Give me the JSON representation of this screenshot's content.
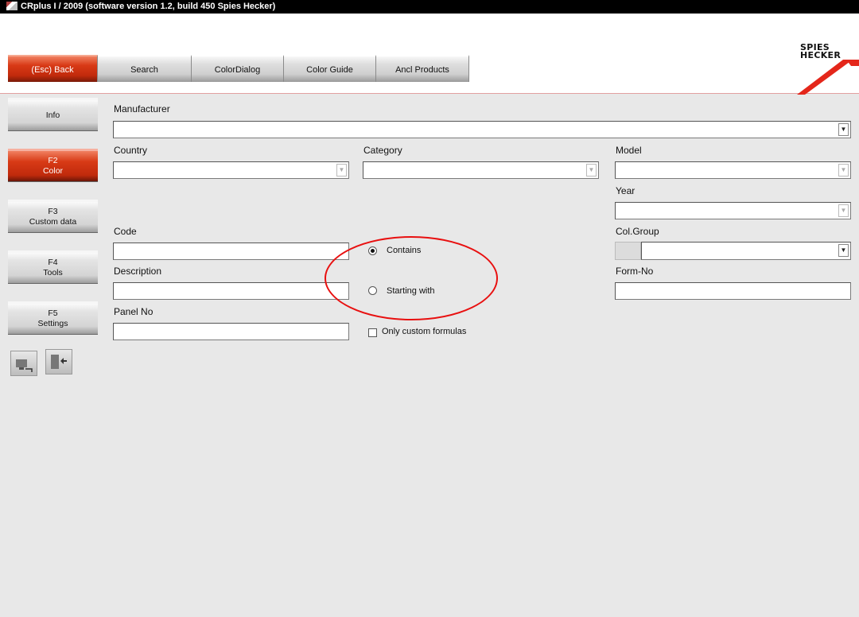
{
  "window": {
    "title": "CRplus I / 2009 (software version 1.2, build 450 Spies Hecker)"
  },
  "toolbar": {
    "back": "(Esc) Back",
    "search": "Search",
    "color_dialog": "ColorDialog",
    "color_guide": "Color Guide",
    "ancl_products": "Ancl Products"
  },
  "logo": {
    "line1": "SPIES",
    "line2": "HECKER"
  },
  "sidebar": {
    "info": "Info",
    "color_key": "F2",
    "color_label": "Color",
    "custom_key": "F3",
    "custom_label": "Custom data",
    "tools_key": "F4",
    "tools_label": "Tools",
    "settings_key": "F5",
    "settings_label": "Settings"
  },
  "form": {
    "manufacturer": {
      "label": "Manufacturer",
      "value": ""
    },
    "country": {
      "label": "Country",
      "value": ""
    },
    "category": {
      "label": "Category",
      "value": ""
    },
    "model": {
      "label": "Model",
      "value": ""
    },
    "year": {
      "label": "Year",
      "value": ""
    },
    "code": {
      "label": "Code",
      "value": ""
    },
    "description": {
      "label": "Description",
      "value": ""
    },
    "panel_no": {
      "label": "Panel No",
      "value": ""
    },
    "col_group": {
      "label": "Col.Group",
      "value": ""
    },
    "form_no": {
      "label": "Form-No",
      "value": ""
    },
    "match_mode": {
      "contains": "Contains",
      "starting_with": "Starting with",
      "selected": "contains"
    },
    "only_custom": {
      "label": "Only custom formulas",
      "checked": false
    }
  },
  "colors": {
    "accent": "#d83a16",
    "annotation": "#e81010"
  }
}
